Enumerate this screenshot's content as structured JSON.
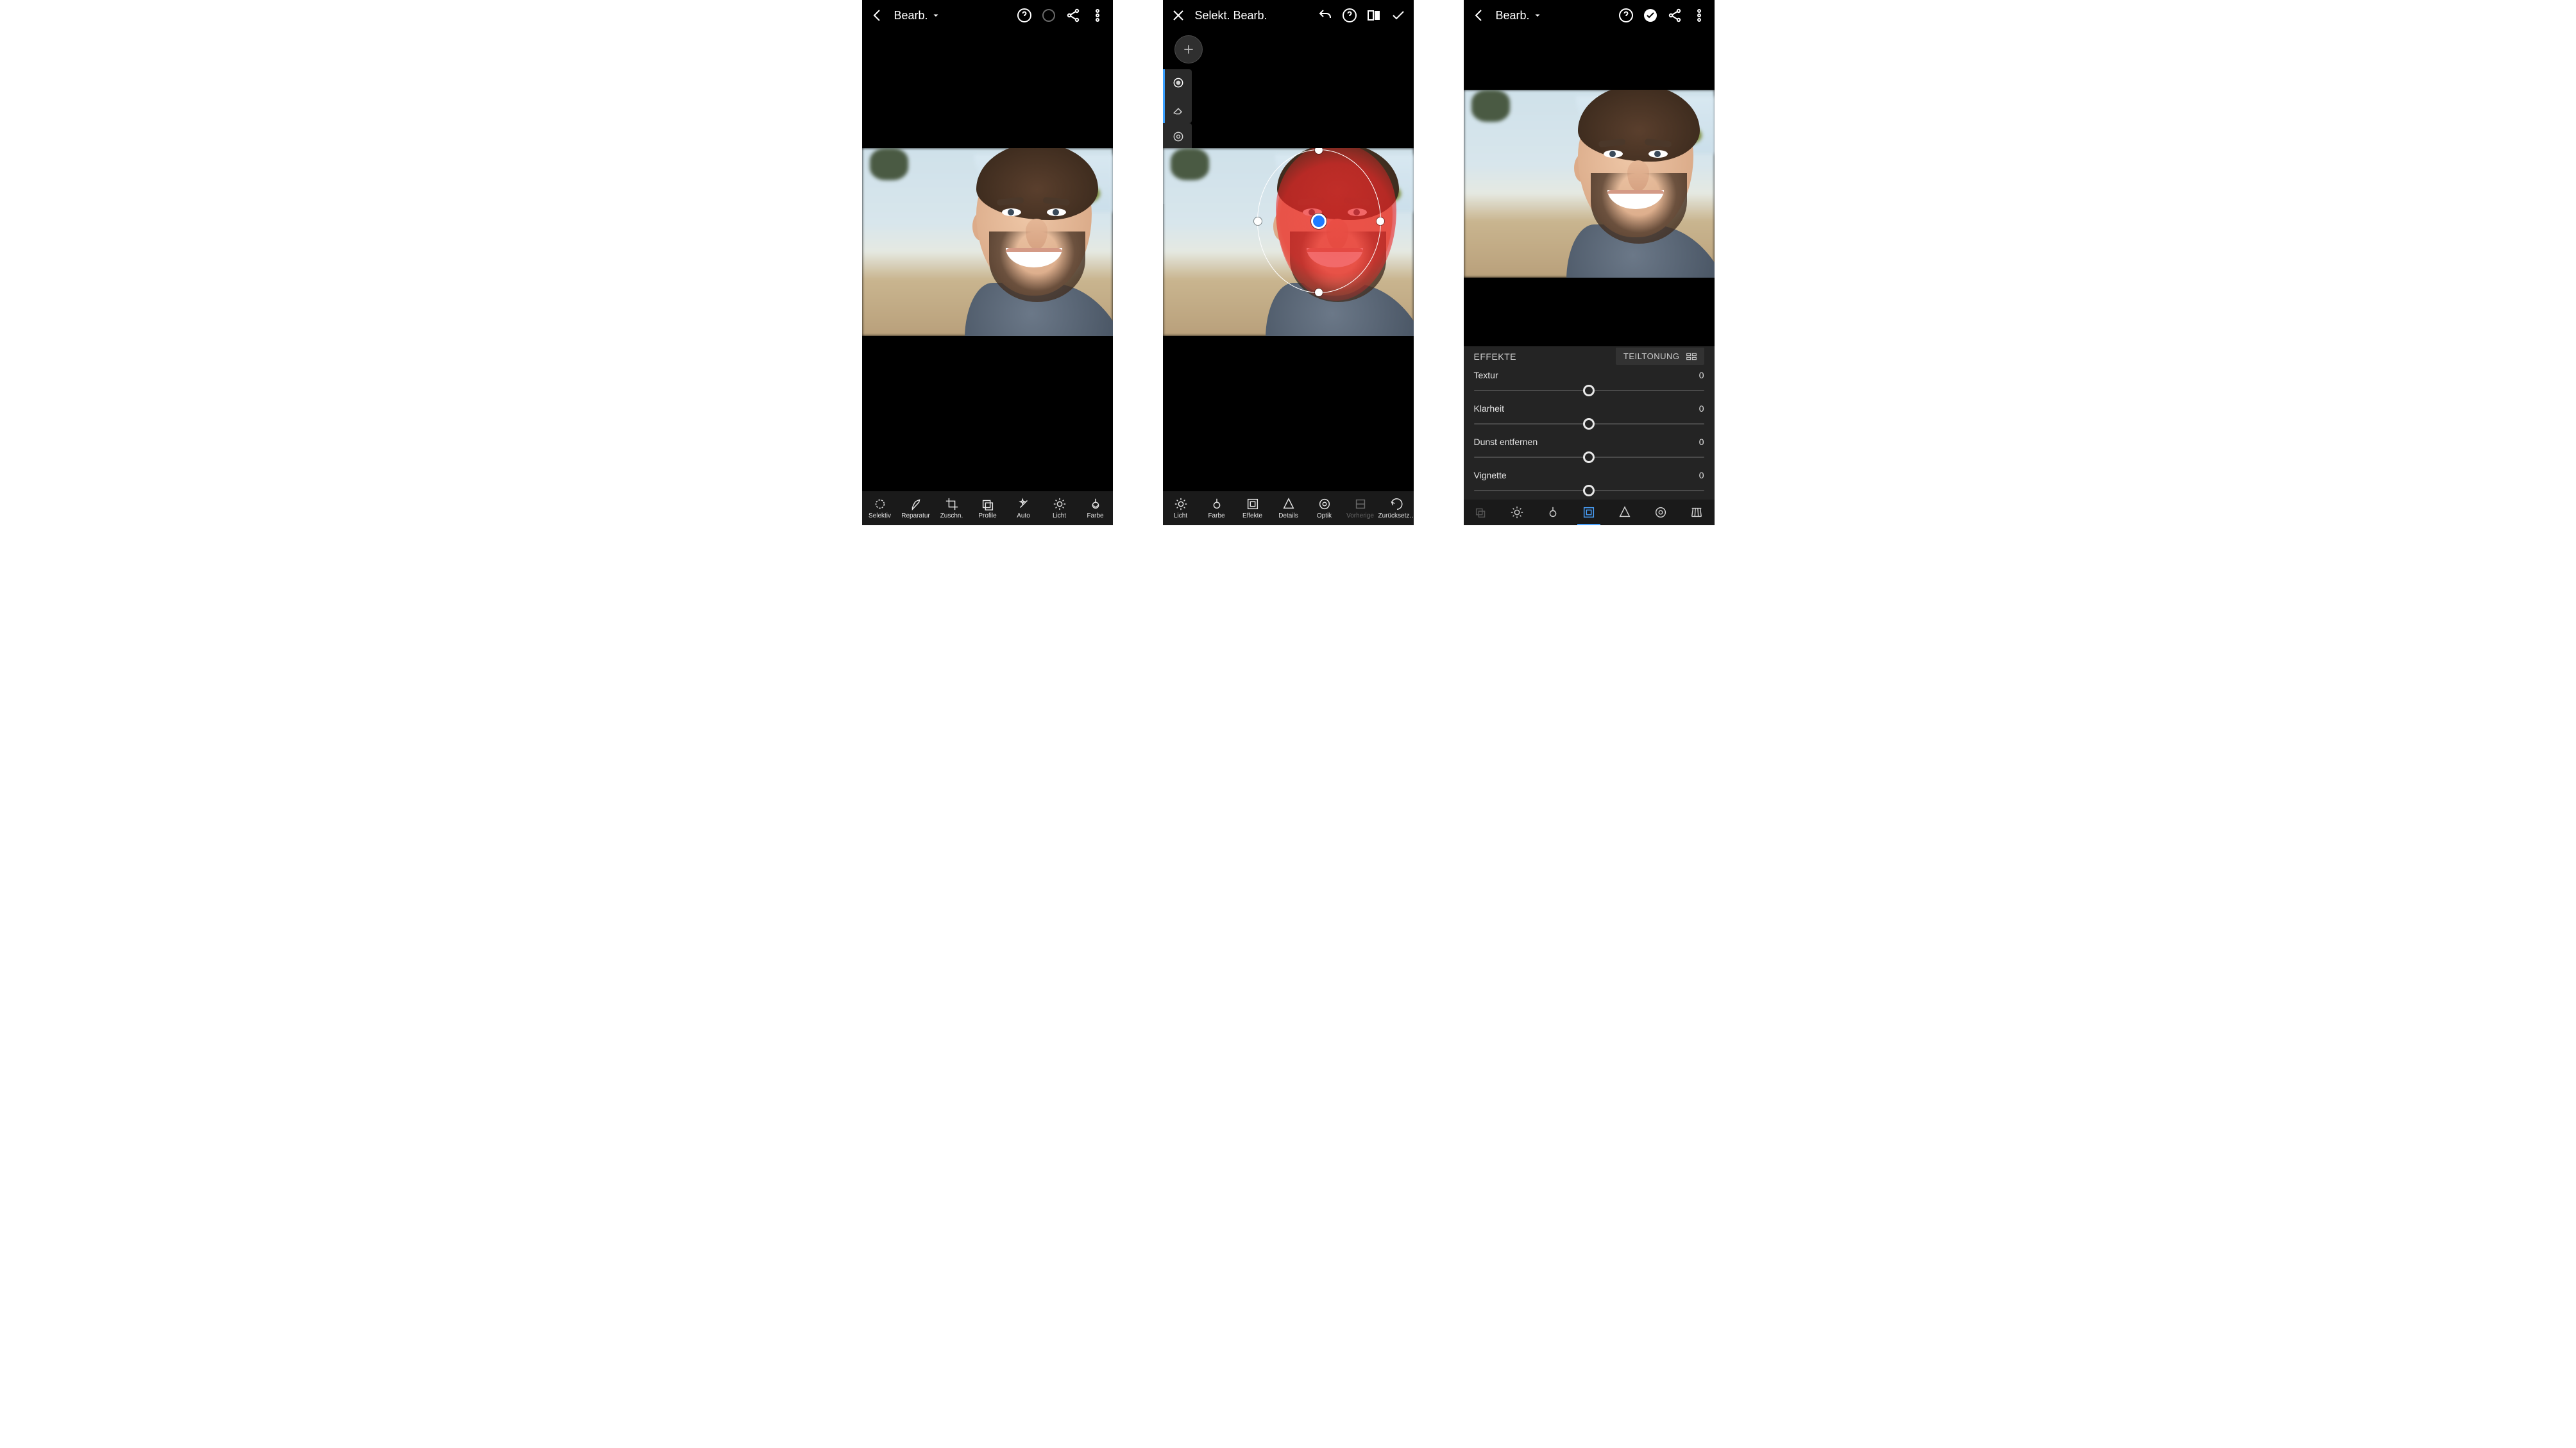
{
  "screen1": {
    "title": "Bearb.",
    "tools": [
      {
        "label": "Selektiv"
      },
      {
        "label": "Reparatur"
      },
      {
        "label": "Zuschn."
      },
      {
        "label": "Profile"
      },
      {
        "label": "Auto"
      },
      {
        "label": "Licht"
      },
      {
        "label": "Farbe"
      }
    ]
  },
  "screen2": {
    "title": "Selekt. Bearb.",
    "tools": [
      {
        "label": "Licht"
      },
      {
        "label": "Farbe"
      },
      {
        "label": "Effekte"
      },
      {
        "label": "Details"
      },
      {
        "label": "Optik"
      },
      {
        "label": "Vorherige"
      },
      {
        "label": "Zurücksetz…"
      }
    ]
  },
  "screen3": {
    "title": "Bearb.",
    "panel": {
      "heading": "EFFEKTE",
      "split": "TEILTONUNG",
      "sliders": [
        {
          "name": "Textur",
          "value": "0",
          "pos": 50
        },
        {
          "name": "Klarheit",
          "value": "0",
          "pos": 50
        },
        {
          "name": "Dunst entfernen",
          "value": "0",
          "pos": 50
        },
        {
          "name": "Vignette",
          "value": "0",
          "pos": 50
        }
      ]
    }
  }
}
